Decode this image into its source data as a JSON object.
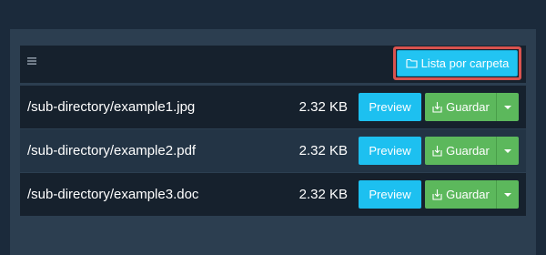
{
  "toolbar": {
    "menu_icon": "hamburger-icon",
    "folder_button_label": "Lista por carpeta",
    "folder_icon": "folder-icon",
    "highlight_color": "#d9534f"
  },
  "files": [
    {
      "path": "/sub-directory/example1.jpg",
      "size": "2.32 KB",
      "preview_label": "Preview",
      "save_label": "Guardar"
    },
    {
      "path": "/sub-directory/example2.pdf",
      "size": "2.32 KB",
      "preview_label": "Preview",
      "save_label": "Guardar"
    },
    {
      "path": "/sub-directory/example3.doc",
      "size": "2.32 KB",
      "preview_label": "Preview",
      "save_label": "Guardar"
    }
  ],
  "colors": {
    "background": "#1b2a3b",
    "panel": "#2c3e50",
    "preview_button": "#1dc0f0",
    "save_button": "#5cb85c"
  }
}
